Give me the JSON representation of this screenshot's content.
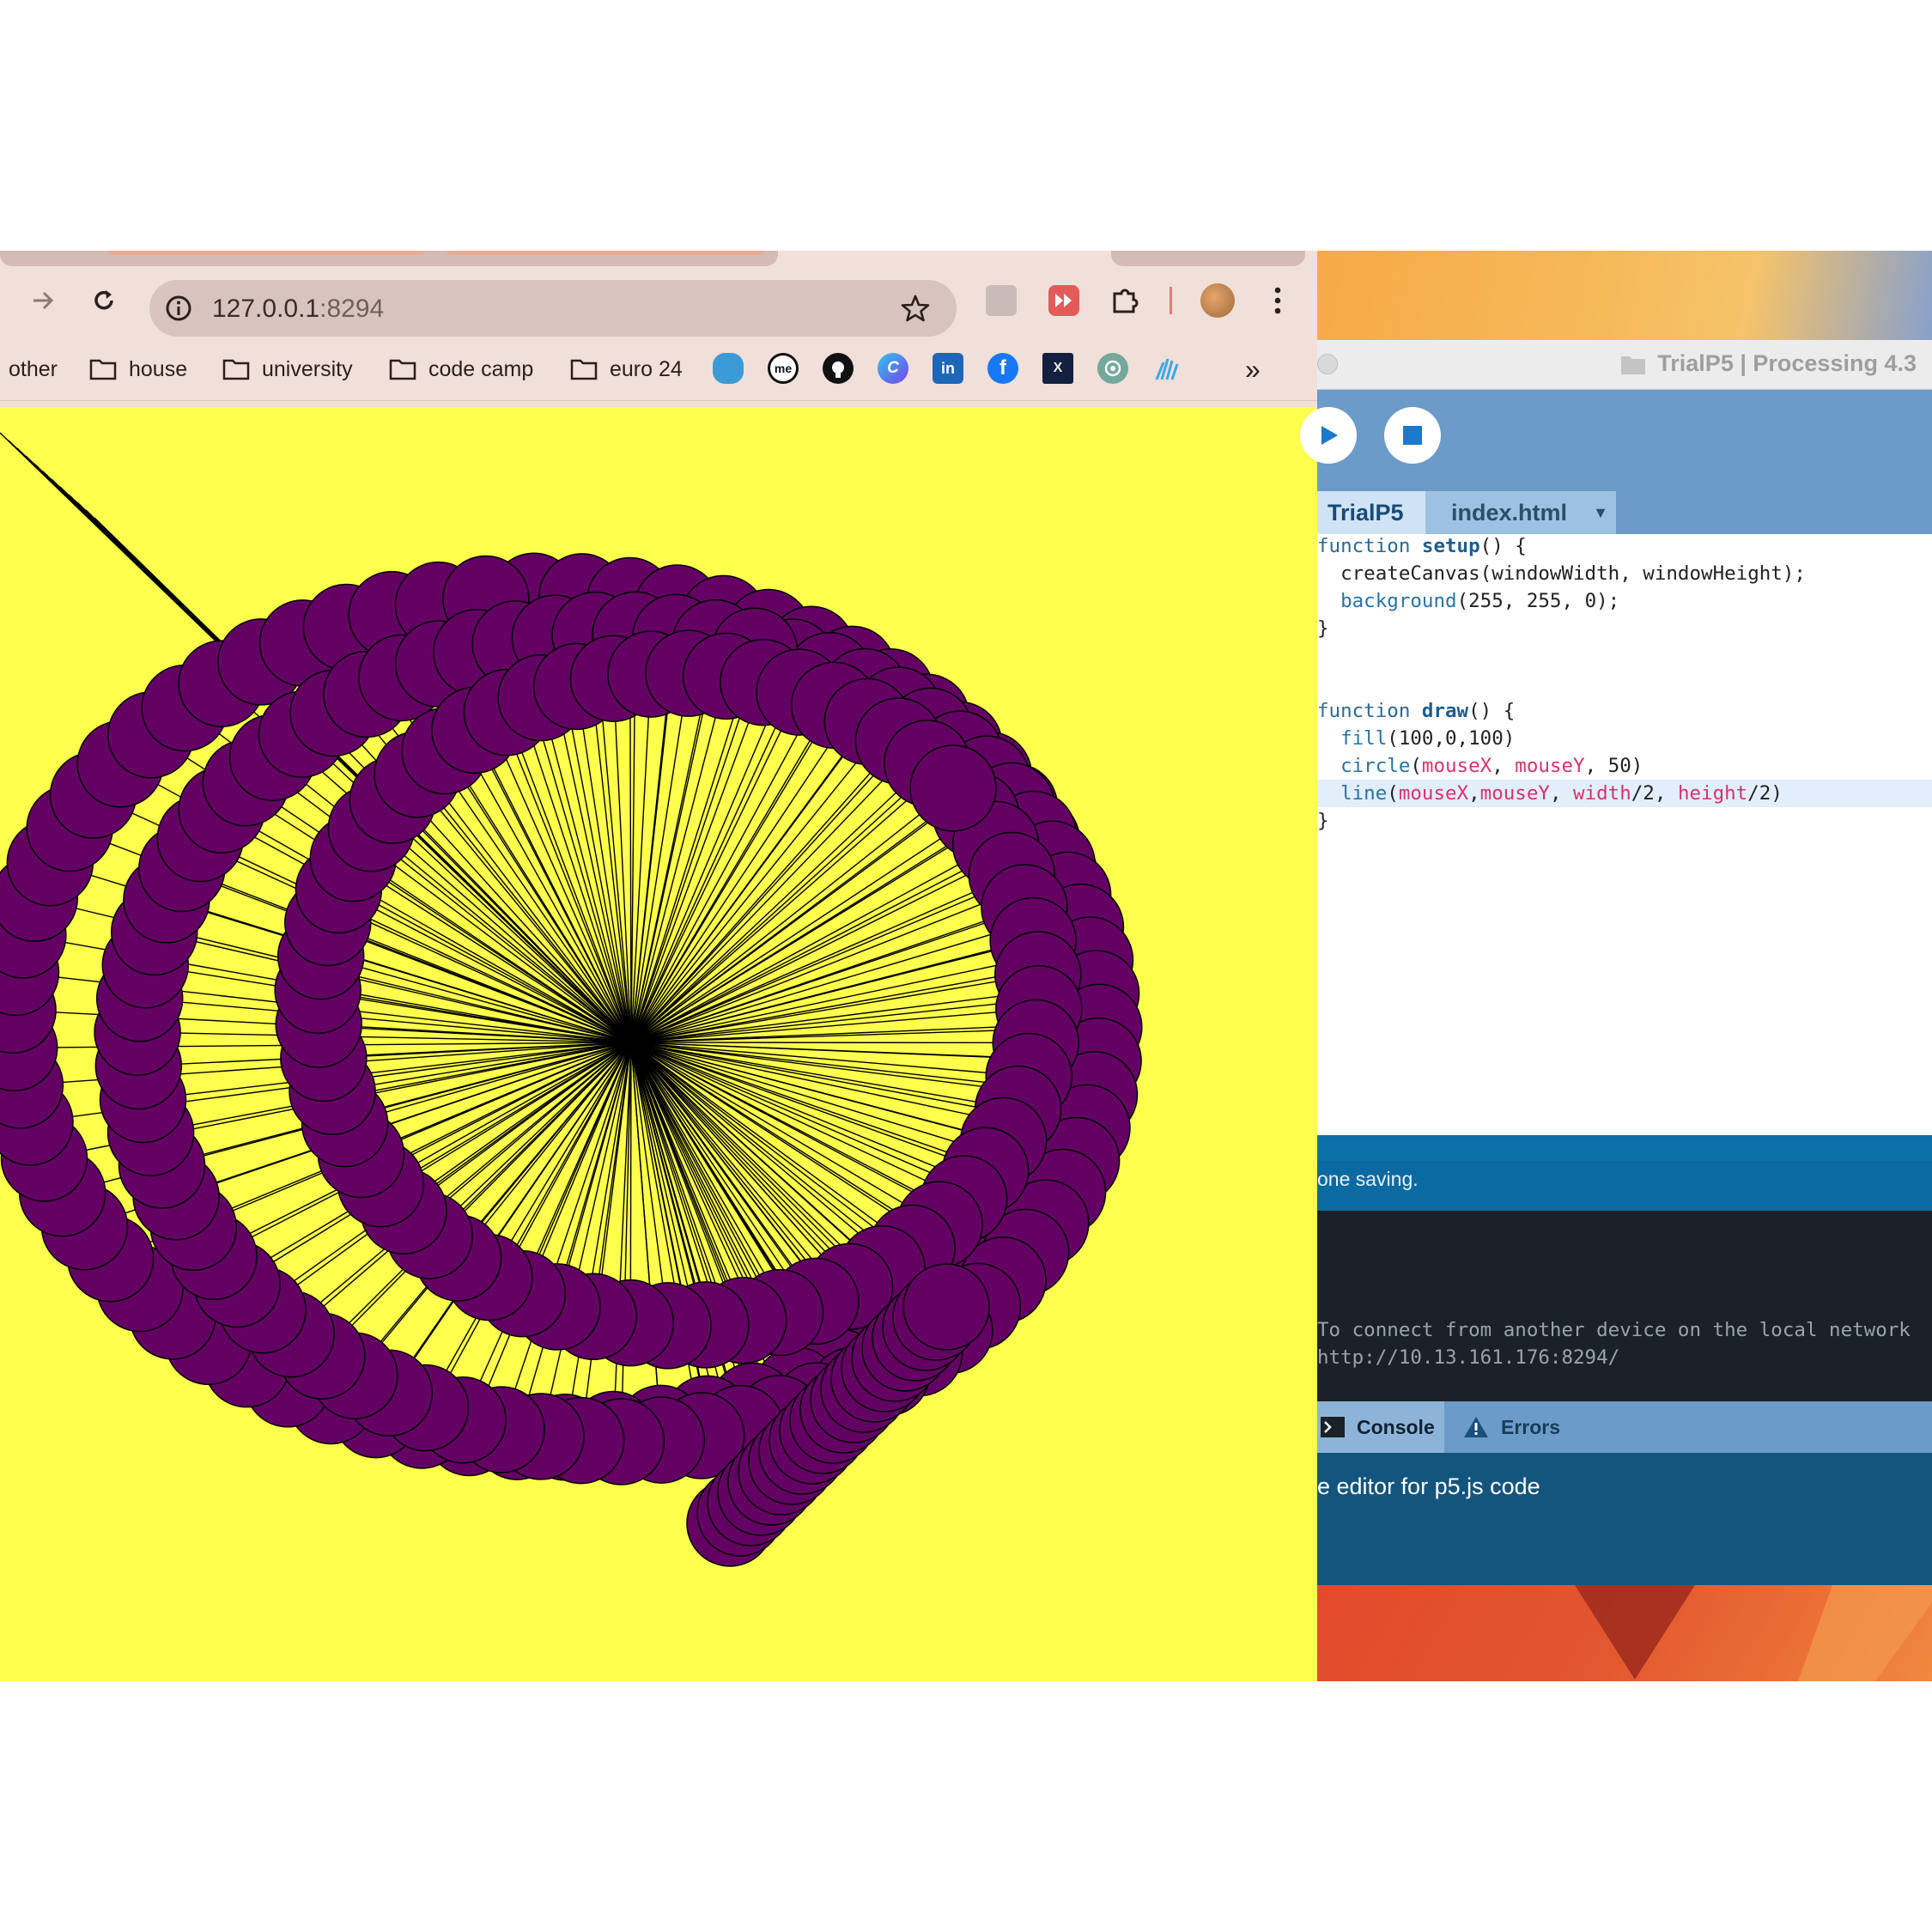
{
  "browser": {
    "url_host": "127.0.0.1",
    "url_port": ":8294",
    "bookmarks": [
      {
        "label": "other"
      },
      {
        "label": "house"
      },
      {
        "label": "university"
      },
      {
        "label": "code camp"
      },
      {
        "label": "euro 24"
      }
    ],
    "extension_icons": [
      "salesforce-cloud-icon",
      "me-icon",
      "github-icon",
      "c-app-icon",
      "linkedin-icon",
      "facebook-icon",
      "dark-app-icon",
      "chatgpt-icon",
      "sparkle-icon"
    ],
    "more_label": "»",
    "canvas_background": "#ffff4d",
    "circle_fill": "#640064"
  },
  "processing": {
    "window_title": "TrialP5 | Processing 4.3",
    "tabs": [
      {
        "label": "TrialP5"
      },
      {
        "label": "index.html"
      }
    ],
    "tab_menu": "▼",
    "status": "one saving.",
    "console_lines": [
      "To connect from another device on the local network",
      "http://10.13.161.176:8294/"
    ],
    "console_tab": "Console",
    "errors_tab": "Errors",
    "footer": "e editor for p5.js code"
  }
}
